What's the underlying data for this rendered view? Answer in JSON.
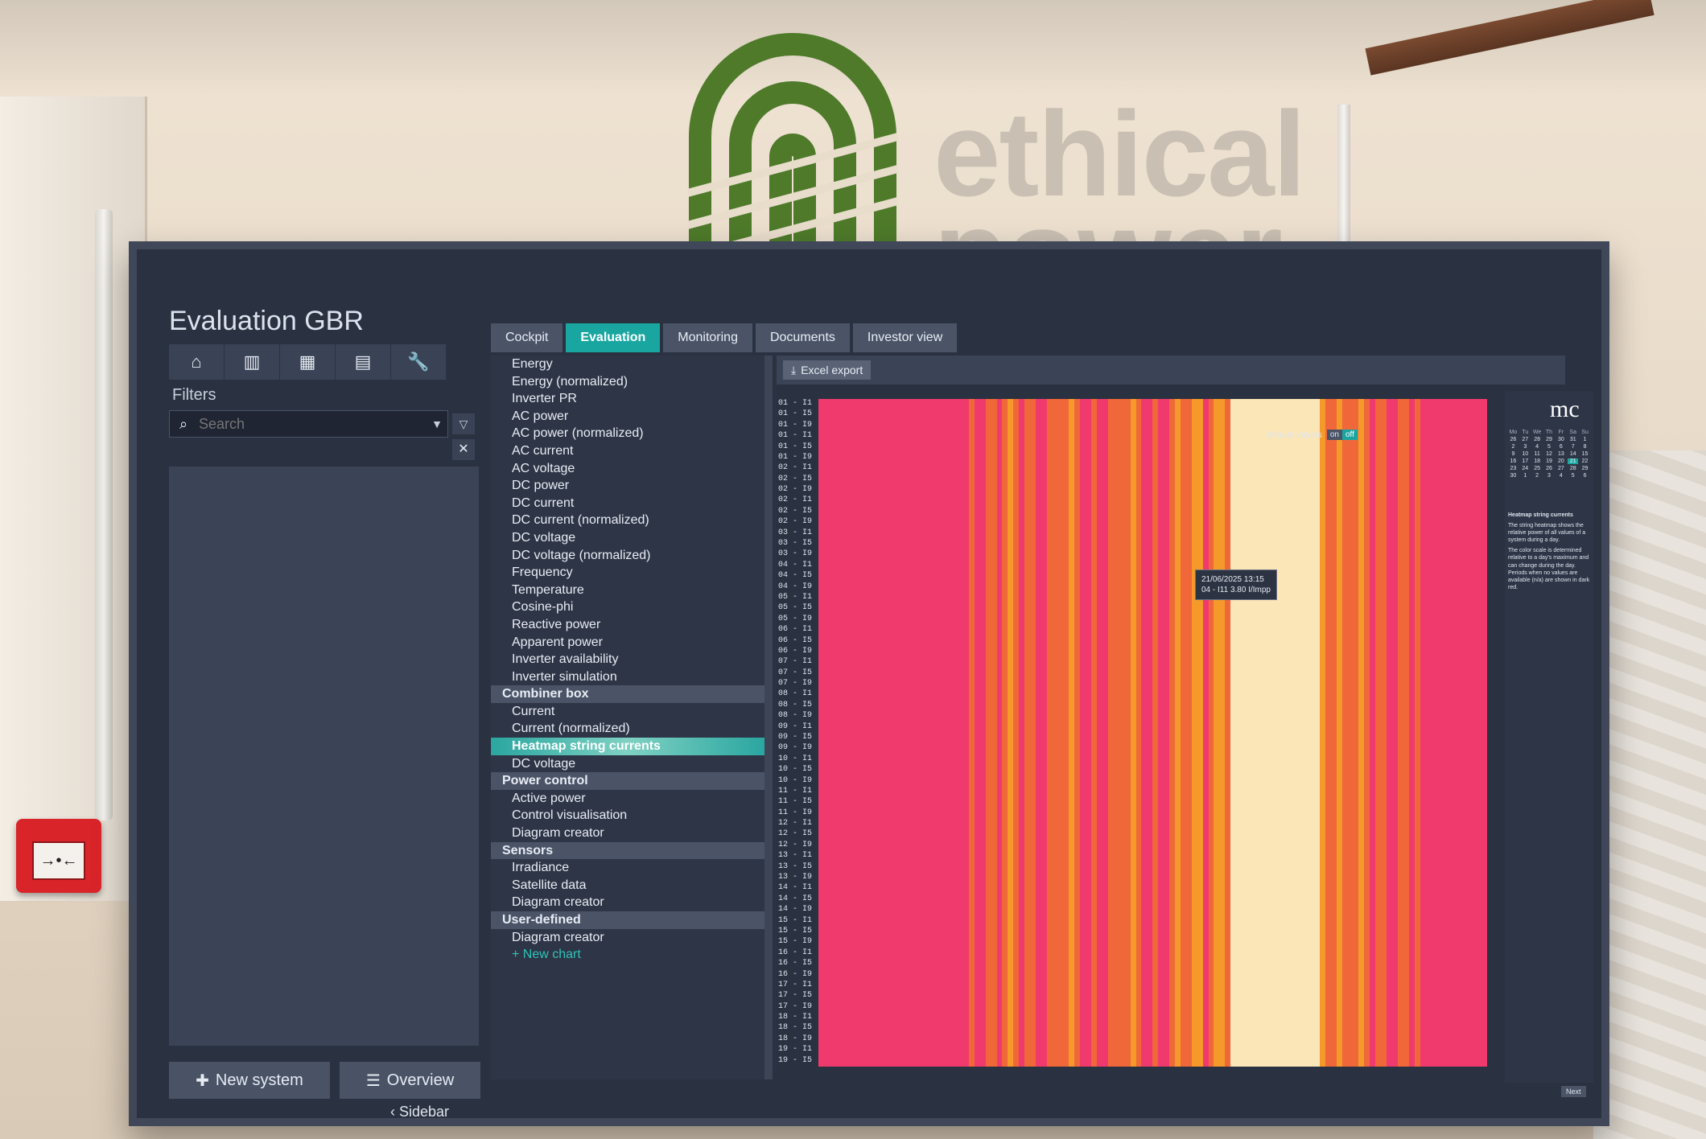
{
  "brand": {
    "line1": "ethical",
    "line2": "power"
  },
  "app": {
    "title": "Evaluation GBR",
    "toolbar_icons": [
      "home-icon",
      "chart-icon",
      "calendar-icon",
      "document-icon",
      "wrench-icon"
    ],
    "filters_label": "Filters",
    "search_placeholder": "Search",
    "new_system_label": "New system",
    "overview_label": "Overview",
    "sidebar_label": "Sidebar"
  },
  "tabs": [
    "Cockpit",
    "Evaluation",
    "Monitoring",
    "Documents",
    "Investor view"
  ],
  "active_tab": "Evaluation",
  "menu": [
    {
      "type": "item",
      "label": "Energy"
    },
    {
      "type": "item",
      "label": "Energy (normalized)"
    },
    {
      "type": "item",
      "label": "Inverter PR"
    },
    {
      "type": "item",
      "label": "AC power"
    },
    {
      "type": "item",
      "label": "AC power (normalized)"
    },
    {
      "type": "item",
      "label": "AC current"
    },
    {
      "type": "item",
      "label": "AC voltage"
    },
    {
      "type": "item",
      "label": "DC power"
    },
    {
      "type": "item",
      "label": "DC current"
    },
    {
      "type": "item",
      "label": "DC current (normalized)"
    },
    {
      "type": "item",
      "label": "DC voltage"
    },
    {
      "type": "item",
      "label": "DC voltage (normalized)"
    },
    {
      "type": "item",
      "label": "Frequency"
    },
    {
      "type": "item",
      "label": "Temperature"
    },
    {
      "type": "item",
      "label": "Cosine-phi"
    },
    {
      "type": "item",
      "label": "Reactive power"
    },
    {
      "type": "item",
      "label": "Apparent power"
    },
    {
      "type": "item",
      "label": "Inverter availability"
    },
    {
      "type": "item",
      "label": "Inverter simulation"
    },
    {
      "type": "group",
      "label": "Combiner box"
    },
    {
      "type": "item",
      "label": "Current"
    },
    {
      "type": "item",
      "label": "Current (normalized)"
    },
    {
      "type": "item",
      "label": "Heatmap string currents",
      "selected": true
    },
    {
      "type": "item",
      "label": "DC voltage"
    },
    {
      "type": "group",
      "label": "Power control"
    },
    {
      "type": "item",
      "label": "Active power"
    },
    {
      "type": "item",
      "label": "Control visualisation"
    },
    {
      "type": "item",
      "label": "Diagram creator"
    },
    {
      "type": "group",
      "label": "Sensors"
    },
    {
      "type": "item",
      "label": "Irradiance"
    },
    {
      "type": "item",
      "label": "Satellite data"
    },
    {
      "type": "item",
      "label": "Diagram creator"
    },
    {
      "type": "group",
      "label": "User-defined"
    },
    {
      "type": "item",
      "label": "Diagram creator"
    },
    {
      "type": "new",
      "label": "New chart"
    }
  ],
  "panel": {
    "excel_export": "Excel export",
    "minute_values_label": "Minute values",
    "toggle_on": "on",
    "toggle_off": "off",
    "tooltip_line1": "21/06/2025 13:15",
    "tooltip_line2": "04 - I11 3.80 I/Impp",
    "next_label": "Next"
  },
  "heatmap": {
    "row_labels": [
      "01 - I1",
      "01 - I5",
      "01 - I9",
      "01 - I1",
      "01 - I5",
      "01 - I9",
      "02 - I1",
      "02 - I5",
      "02 - I9",
      "02 - I1",
      "02 - I5",
      "02 - I9",
      "03 - I1",
      "03 - I5",
      "03 - I9",
      "04 - I1",
      "04 - I5",
      "04 - I9",
      "05 - I1",
      "05 - I5",
      "05 - I9",
      "06 - I1",
      "06 - I5",
      "06 - I9",
      "07 - I1",
      "07 - I5",
      "07 - I9",
      "08 - I1",
      "08 - I5",
      "08 - I9",
      "09 - I1",
      "09 - I5",
      "09 - I9",
      "10 - I1",
      "10 - I5",
      "10 - I9",
      "11 - I1",
      "11 - I5",
      "11 - I9",
      "12 - I1",
      "12 - I5",
      "12 - I9",
      "13 - I1",
      "13 - I5",
      "13 - I9",
      "14 - I1",
      "14 - I5",
      "14 - I9",
      "15 - I1",
      "15 - I5",
      "15 - I9",
      "16 - I1",
      "16 - I5",
      "16 - I9",
      "17 - I1",
      "17 - I5",
      "17 - I9",
      "18 - I1",
      "18 - I5",
      "18 - I9",
      "19 - I1",
      "19 - I5"
    ],
    "colors": {
      "low": "#f03a6e",
      "mid": "#f0673a",
      "high": "#f59a2a",
      "peak": "#fbe6b8"
    }
  },
  "calendar": {
    "weekdays": [
      "Mo",
      "Tu",
      "We",
      "Th",
      "Fr",
      "Sa",
      "Su"
    ],
    "days": [
      "26",
      "27",
      "28",
      "29",
      "30",
      "31",
      "1",
      "2",
      "3",
      "4",
      "5",
      "6",
      "7",
      "8",
      "9",
      "10",
      "11",
      "12",
      "13",
      "14",
      "15",
      "16",
      "17",
      "18",
      "19",
      "20",
      "21",
      "22",
      "23",
      "24",
      "25",
      "26",
      "27",
      "28",
      "29",
      "30",
      "1",
      "2",
      "3",
      "4",
      "5",
      "6"
    ],
    "selected": "21",
    "logo": "mc"
  },
  "info": {
    "title": "Heatmap string currents",
    "text1": "The string heatmap shows the relative power of all values of a system during a day.",
    "text2": "The color scale is determined relative to a day's maximum and can change during the day. Periods when no values are available (n/a) are shown in dark red."
  },
  "fire_alarm": {
    "symbol": "→•←"
  }
}
